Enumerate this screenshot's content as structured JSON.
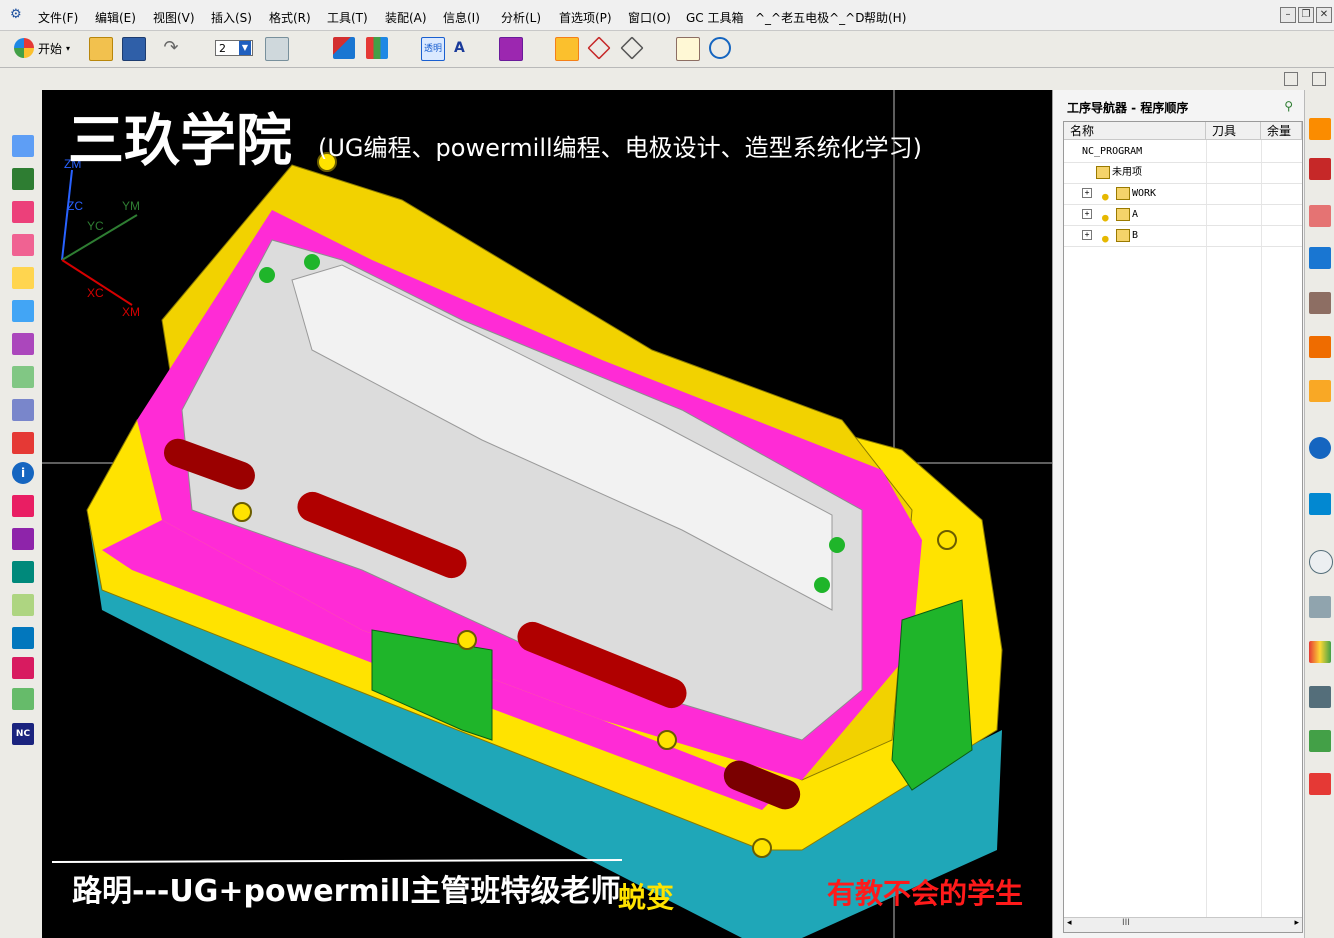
{
  "menubar": {
    "app_icon": "nx-app-icon",
    "items": [
      "文件(F)",
      "编辑(E)",
      "视图(V)",
      "插入(S)",
      "格式(R)",
      "工具(T)",
      "装配(A)",
      "信息(I)",
      "分析(L)",
      "首选项(P)",
      "窗口(O)",
      "GC 工具箱",
      "^_^老五电极^_^D",
      "帮助(H)"
    ]
  },
  "toolbar": {
    "start_label": "开始",
    "layer_value": "2"
  },
  "viewport": {
    "banner_title": "三玖学院",
    "banner_subtitle": "(UG编程、powermill编程、电极设计、造型系统化学习)",
    "bottom_caption": "路明---UG+powermill主管班特级老师",
    "bottom_yellow": "蜕变",
    "bottom_red": "有教不会的学生",
    "axes": [
      "ZM",
      "ZC",
      "YM",
      "YC",
      "XC",
      "XM"
    ]
  },
  "navigator": {
    "title": "工序导航器 - 程序顺序",
    "columns": [
      "名称",
      "刀具",
      "余量"
    ],
    "rows": [
      {
        "label": "NC_PROGRAM",
        "level": 0,
        "expander": false,
        "light": false,
        "folder": false
      },
      {
        "label": "未用项",
        "level": 1,
        "expander": false,
        "light": false,
        "folder": true
      },
      {
        "label": "WORK",
        "level": 1,
        "expander": true,
        "light": true,
        "folder": true
      },
      {
        "label": "A",
        "level": 1,
        "expander": true,
        "light": true,
        "folder": true
      },
      {
        "label": "B",
        "level": 1,
        "expander": true,
        "light": true,
        "folder": true
      }
    ],
    "scroll_thumb": "III"
  },
  "colors": {
    "magenta": "#ff2bd6",
    "yellow": "#ffe300",
    "cyan": "#1fa7b8",
    "grey": "#dcdcdc",
    "green": "#1fb52a",
    "red": "#b00000",
    "darkred": "#7a0000"
  }
}
